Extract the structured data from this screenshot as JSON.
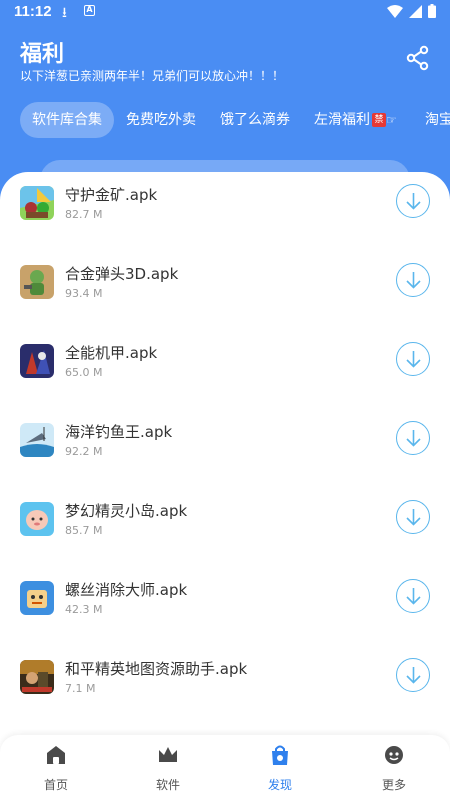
{
  "status_bar": {
    "time": "11:12"
  },
  "header": {
    "title": "福利",
    "subtitle": "以下洋葱已亲测两年半！兄弟们可以放心冲！！！"
  },
  "tabs": [
    {
      "label": "软件库合集",
      "active": true
    },
    {
      "label": "免费吃外卖",
      "active": false
    },
    {
      "label": "饿了么滴券",
      "active": false
    },
    {
      "label": "左滑福利",
      "active": false,
      "badge": "禁"
    },
    {
      "label": "淘宝",
      "active": false
    }
  ],
  "apps": [
    {
      "name": "守护金矿.apk",
      "size": "82.7 M",
      "icon": "guard-gold-mine-icon"
    },
    {
      "name": "合金弹头3D.apk",
      "size": "93.4 M",
      "icon": "metal-slug-icon"
    },
    {
      "name": "全能机甲.apk",
      "size": "65.0 M",
      "icon": "mecha-icon"
    },
    {
      "name": "海洋钓鱼王.apk",
      "size": "92.2 M",
      "icon": "fishing-icon"
    },
    {
      "name": "梦幻精灵小岛.apk",
      "size": "85.7 M",
      "icon": "sprite-island-icon"
    },
    {
      "name": "螺丝消除大师.apk",
      "size": "42.3 M",
      "icon": "screw-master-icon"
    },
    {
      "name": "和平精英地图资源助手.apk",
      "size": "7.1 M",
      "icon": "pubg-map-icon"
    }
  ],
  "nav": [
    {
      "label": "首页",
      "icon": "home-icon",
      "active": false
    },
    {
      "label": "软件",
      "icon": "crown-icon",
      "active": false
    },
    {
      "label": "发现",
      "icon": "bag-icon",
      "active": true
    },
    {
      "label": "更多",
      "icon": "more-icon",
      "active": false
    }
  ],
  "colors": {
    "primary": "#4a8df3",
    "accent": "#2f80ed",
    "download": "#5ab6ec"
  }
}
